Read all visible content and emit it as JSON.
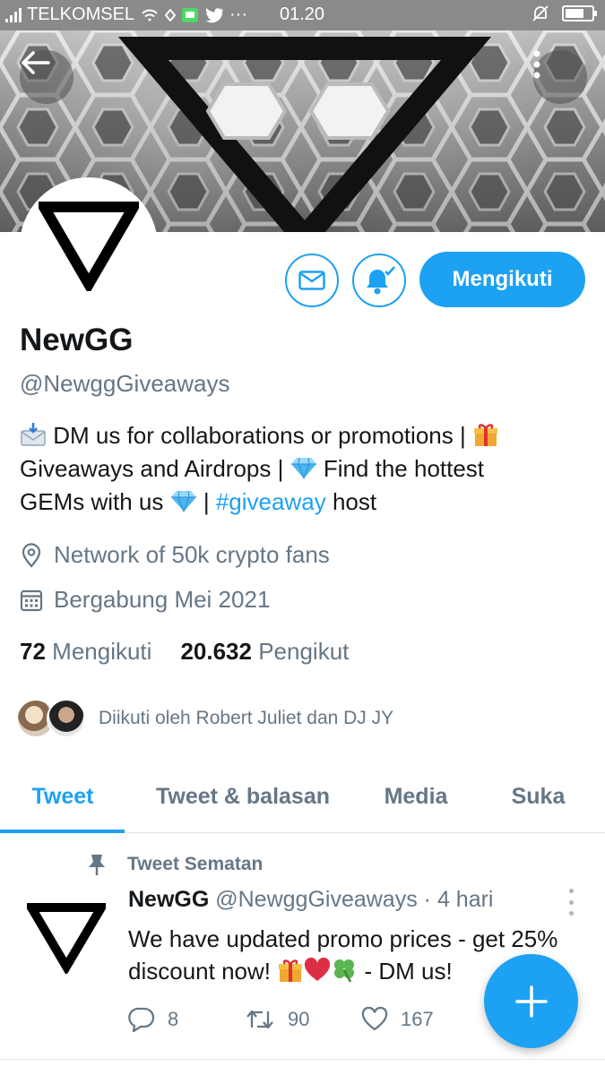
{
  "status_bar": {
    "carrier": "TELKOMSEL",
    "time": "01.20",
    "dots": "···"
  },
  "profile": {
    "name": "NewGG",
    "handle": "@NewggGiveaways",
    "follow_button_label": "Mengikuti",
    "bio": {
      "line1_text": "DM us for collaborations or promotions |",
      "line2_a": "Giveaways and Airdrops |",
      "line2_b": "Find the hottest",
      "line3_a": "GEMs with us",
      "line3_sep": "|",
      "hashtag": "#giveaway",
      "line3_b": "host"
    },
    "location": "Network of 50k crypto fans",
    "joined": "Bergabung Mei 2021",
    "following_count": "72",
    "following_label": "Mengikuti",
    "followers_count": "20.632",
    "followers_label": "Pengikut",
    "followed_by": "Diikuti oleh Robert Juliet dan DJ JY"
  },
  "tabs": [
    {
      "label": "Tweet",
      "active": true
    },
    {
      "label": "Tweet & balasan",
      "active": false
    },
    {
      "label": "Media",
      "active": false
    },
    {
      "label": "Suka",
      "active": false
    }
  ],
  "pinned_tweet": {
    "pinned_label": "Tweet Sematan",
    "author_name": "NewGG",
    "author_handle": "@NewggGiveaways",
    "separator": "·",
    "time": "4 hari",
    "text_line1": "We have updated promo prices - get 25%",
    "text_line2_a": "discount now!",
    "text_line2_b": "- DM us!",
    "replies": "8",
    "retweets": "90",
    "likes": "167"
  },
  "icons": {
    "back": "arrow-left-icon",
    "more": "more-vertical-icon",
    "message": "mail-icon",
    "notifications": "bell-check-icon",
    "location": "location-pin-icon",
    "calendar": "calendar-icon",
    "pin": "pin-icon",
    "reply": "reply-icon",
    "retweet": "retweet-icon",
    "like": "heart-icon",
    "compose": "plus-icon"
  },
  "colors": {
    "accent": "#1da1f2",
    "secondary_text": "#657786",
    "primary_text": "#14171a",
    "status_bar": "#8a8a8a"
  }
}
